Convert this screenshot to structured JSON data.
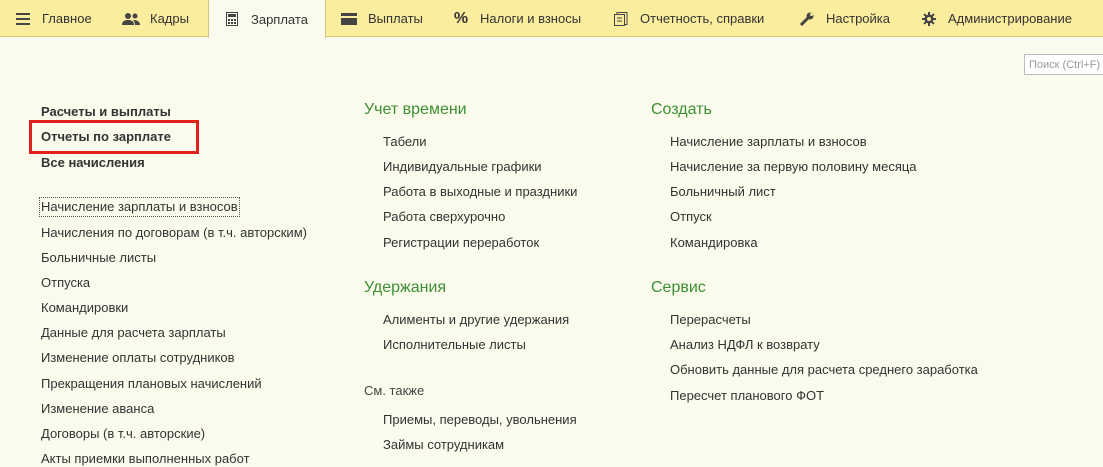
{
  "menu": {
    "tabs": [
      {
        "label": "Главное",
        "icon": "hamburger-icon"
      },
      {
        "label": "Кадры",
        "icon": "people-icon"
      },
      {
        "label": "Зарплата",
        "icon": "calculator-icon",
        "active": true
      },
      {
        "label": "Выплаты",
        "icon": "wallet-icon"
      },
      {
        "label": "Налоги и взносы",
        "icon": "percent-icon"
      },
      {
        "label": "Отчетность, справки",
        "icon": "report-icon"
      },
      {
        "label": "Настройка",
        "icon": "wrench-icon"
      },
      {
        "label": "Администрирование",
        "icon": "gear-icon"
      }
    ]
  },
  "search": {
    "placeholder": "Поиск (Ctrl+F)"
  },
  "left": {
    "bold_links": [
      "Расчеты и выплаты",
      "Отчеты по зарплате",
      "Все начисления"
    ],
    "links": [
      "Начисление зарплаты и взносов",
      "Начисления по договорам (в т.ч. авторским)",
      "Больничные листы",
      "Отпуска",
      "Командировки",
      "Данные для расчета зарплаты",
      "Изменение оплаты сотрудников",
      "Прекращения плановых начислений",
      "Изменение аванса",
      "Договоры (в т.ч. авторские)",
      "Акты приемки выполненных работ"
    ]
  },
  "middle": {
    "time_title": "Учет времени",
    "time_links": [
      "Табели",
      "Индивидуальные графики",
      "Работа в выходные и праздники",
      "Работа сверхурочно",
      "Регистрации переработок"
    ],
    "ded_title": "Удержания",
    "ded_links": [
      "Алименты и другие удержания",
      "Исполнительные листы"
    ],
    "see_also": "См. также",
    "see_links": [
      "Приемы, переводы, увольнения",
      "Займы сотрудникам"
    ]
  },
  "right": {
    "create_title": "Создать",
    "create_links": [
      "Начисление зарплаты и взносов",
      "Начисление за первую половину месяца",
      "Больничный лист",
      "Отпуск",
      "Командировка"
    ],
    "service_title": "Сервис",
    "service_links": [
      "Перерасчеты",
      "Анализ НДФЛ к возврату",
      "Обновить данные для расчета среднего заработка",
      "Пересчет планового ФОТ"
    ]
  }
}
